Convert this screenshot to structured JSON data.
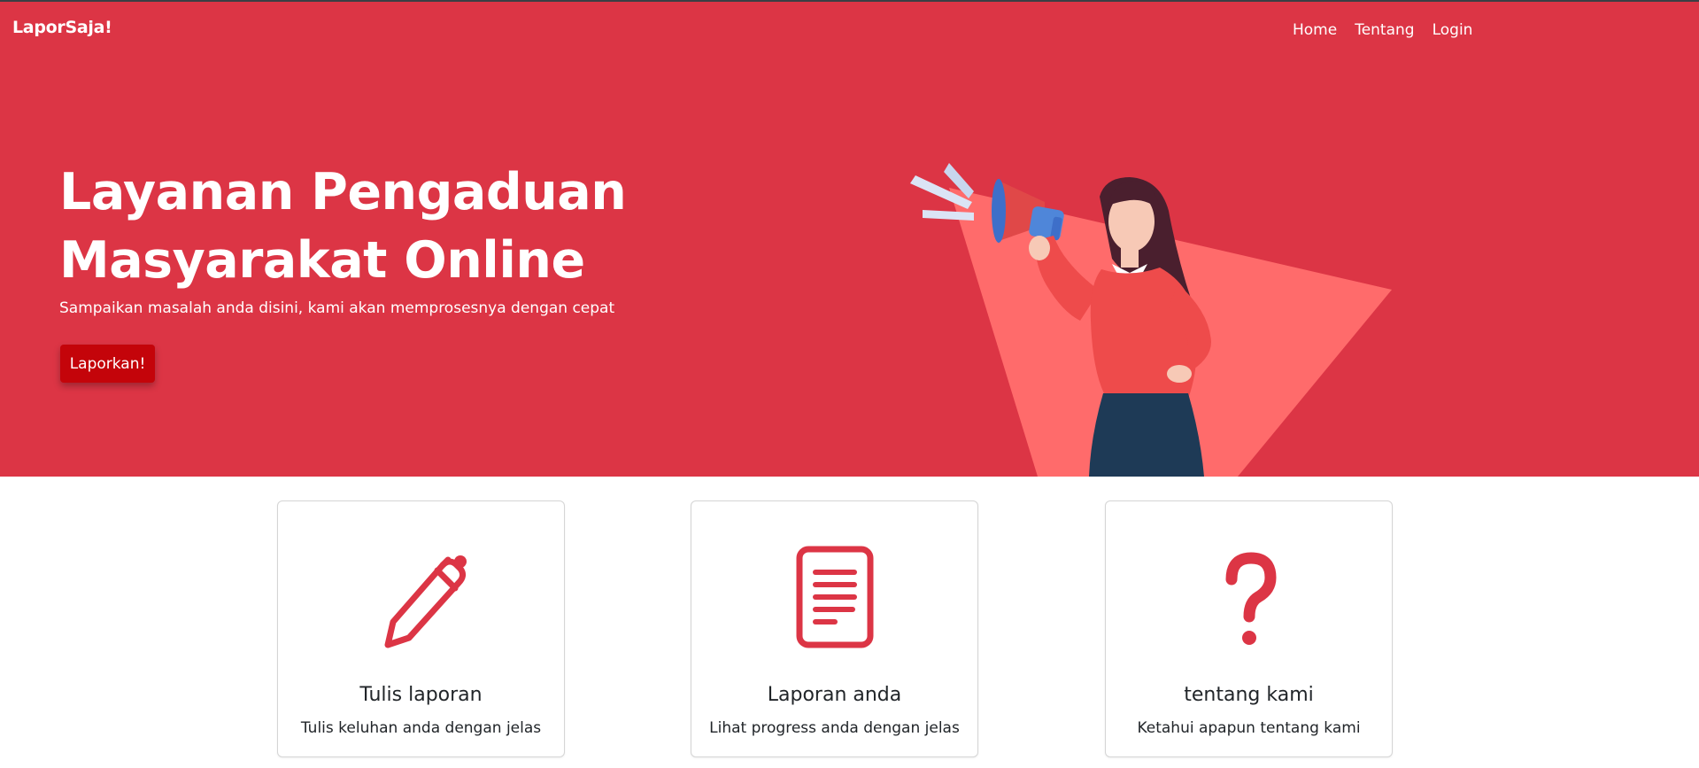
{
  "brand": "LaporSaja!",
  "nav": {
    "home": "Home",
    "tentang": "Tentang",
    "login": "Login"
  },
  "hero": {
    "title_line1": "Layanan Pengaduan",
    "title_line2": "Masyarakat Online",
    "subtitle": "Sampaikan masalah anda disini, kami akan memprosesnya dengan cepat",
    "cta": "Laporkan!"
  },
  "cards": [
    {
      "title": "Tulis laporan",
      "desc": "Tulis keluhan anda dengan jelas",
      "icon": "pen-icon"
    },
    {
      "title": "Laporan anda",
      "desc": "Lihat progress anda dengan jelas",
      "icon": "document-icon"
    },
    {
      "title": "tentang kami",
      "desc": "Ketahui apapun tentang kami",
      "icon": "question-icon"
    }
  ],
  "colors": {
    "primary": "#dc3545",
    "button": "#c4040a",
    "accent_light": "#ff6b6b"
  }
}
